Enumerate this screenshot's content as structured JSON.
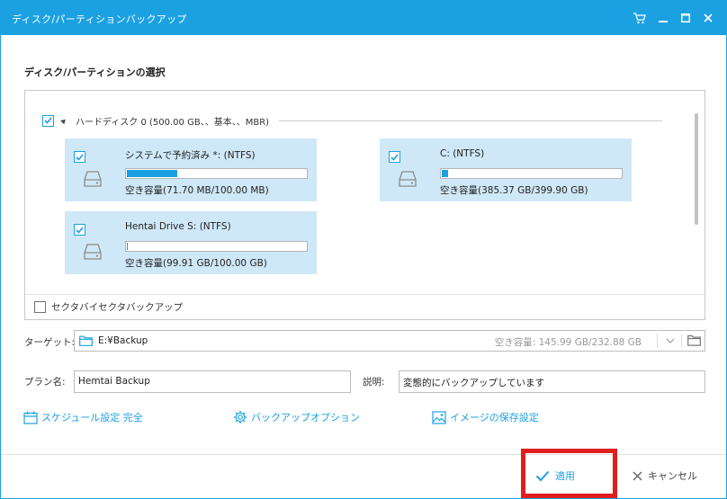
{
  "window": {
    "title": "ディスク/パーティションバックアップ"
  },
  "titlebar_icons": [
    "cart-icon",
    "minimize-icon",
    "maximize-icon",
    "close-icon"
  ],
  "selection": {
    "title": "ディスク/パーティションの選択",
    "disk_label": "ハードディスク 0 (500.00 GB、、基本、、MBR)",
    "partitions": [
      {
        "name": "システムで予約済み *: (NTFS)",
        "free": "空き容量(71.70 MB/100.00 MB)",
        "used_fraction": 0.283,
        "checked": true
      },
      {
        "name": "C: (NTFS)",
        "free": "空き容量(385.37 GB/399.90 GB)",
        "used_fraction": 0.036,
        "checked": true
      },
      {
        "name": "Hentai Drive S: (NTFS)",
        "free": "空き容量(99.91 GB/100.00 GB)",
        "used_fraction": 0.001,
        "checked": true
      }
    ],
    "sector_label": "セクタバイセクタバックアップ",
    "sector_checked": false
  },
  "target": {
    "label": "ターゲット:",
    "path": "E:¥Backup",
    "free": "空き容量: 145.99 GB/232.88 GB"
  },
  "plan": {
    "label": "プラン名:",
    "value": "Hemtai Backup"
  },
  "description": {
    "label": "説明:",
    "value": "変態的にバックアップしています"
  },
  "links": {
    "schedule": "スケジュール設定 完全",
    "options": "バックアップオプション",
    "image": "イメージの保存設定"
  },
  "footer": {
    "apply": "適用",
    "cancel": "キャンセル"
  },
  "colors": {
    "accent": "#1ba1e2",
    "partition_bg": "#cfe8f7",
    "highlight": "#e01e1e"
  }
}
